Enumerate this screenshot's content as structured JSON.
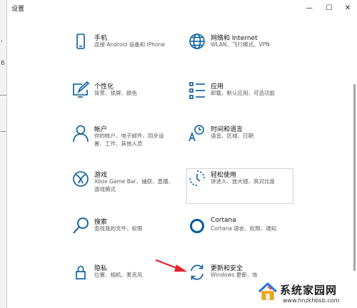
{
  "window": {
    "title": "设置",
    "controls": {
      "minimize": "—",
      "maximize": "☐",
      "close": "✕"
    }
  },
  "background_window": {
    "glyphs": [
      "‘",
      "6"
    ]
  },
  "tiles": [
    {
      "title": "手机",
      "desc": "连接 Android 设备和 iPhone",
      "icon": "phone-icon"
    },
    {
      "title": "网络和 Internet",
      "desc": "WLAN、飞行模式、VPN",
      "icon": "globe-icon"
    },
    {
      "title": "个性化",
      "desc": "背景、锁屏、颜色",
      "icon": "personalization-icon"
    },
    {
      "title": "应用",
      "desc": "卸载、默认应用、可选功能",
      "icon": "apps-icon"
    },
    {
      "title": "帐户",
      "desc": "你的帐户、电子邮件、同步设置、工作、其他人员",
      "icon": "account-icon"
    },
    {
      "title": "时间和语言",
      "desc": "语音、区域、日期",
      "icon": "time-language-icon"
    },
    {
      "title": "游戏",
      "desc": "Xbox Game Bar、捕获、直播、游戏模式",
      "icon": "xbox-icon"
    },
    {
      "title": "轻松使用",
      "desc": "讲述人、放大镜、高对比度",
      "icon": "ease-of-access-icon"
    },
    {
      "title": "搜索",
      "desc": "查找我的文件、权限",
      "icon": "search-icon"
    },
    {
      "title": "Cortana",
      "desc": "Cortana 语言、权限、通知",
      "icon": "cortana-icon"
    },
    {
      "title": "隐私",
      "desc": "位置、相机、麦克风",
      "icon": "lock-icon"
    },
    {
      "title": "更新和安全",
      "desc": "Windows 更新、恢",
      "icon": "update-icon"
    }
  ],
  "watermark": {
    "title": "系统家园网",
    "url": "www.hnzkhbsb.com"
  },
  "colors": {
    "icon_blue": "#005a9e",
    "annotation_red": "#e8202a"
  }
}
